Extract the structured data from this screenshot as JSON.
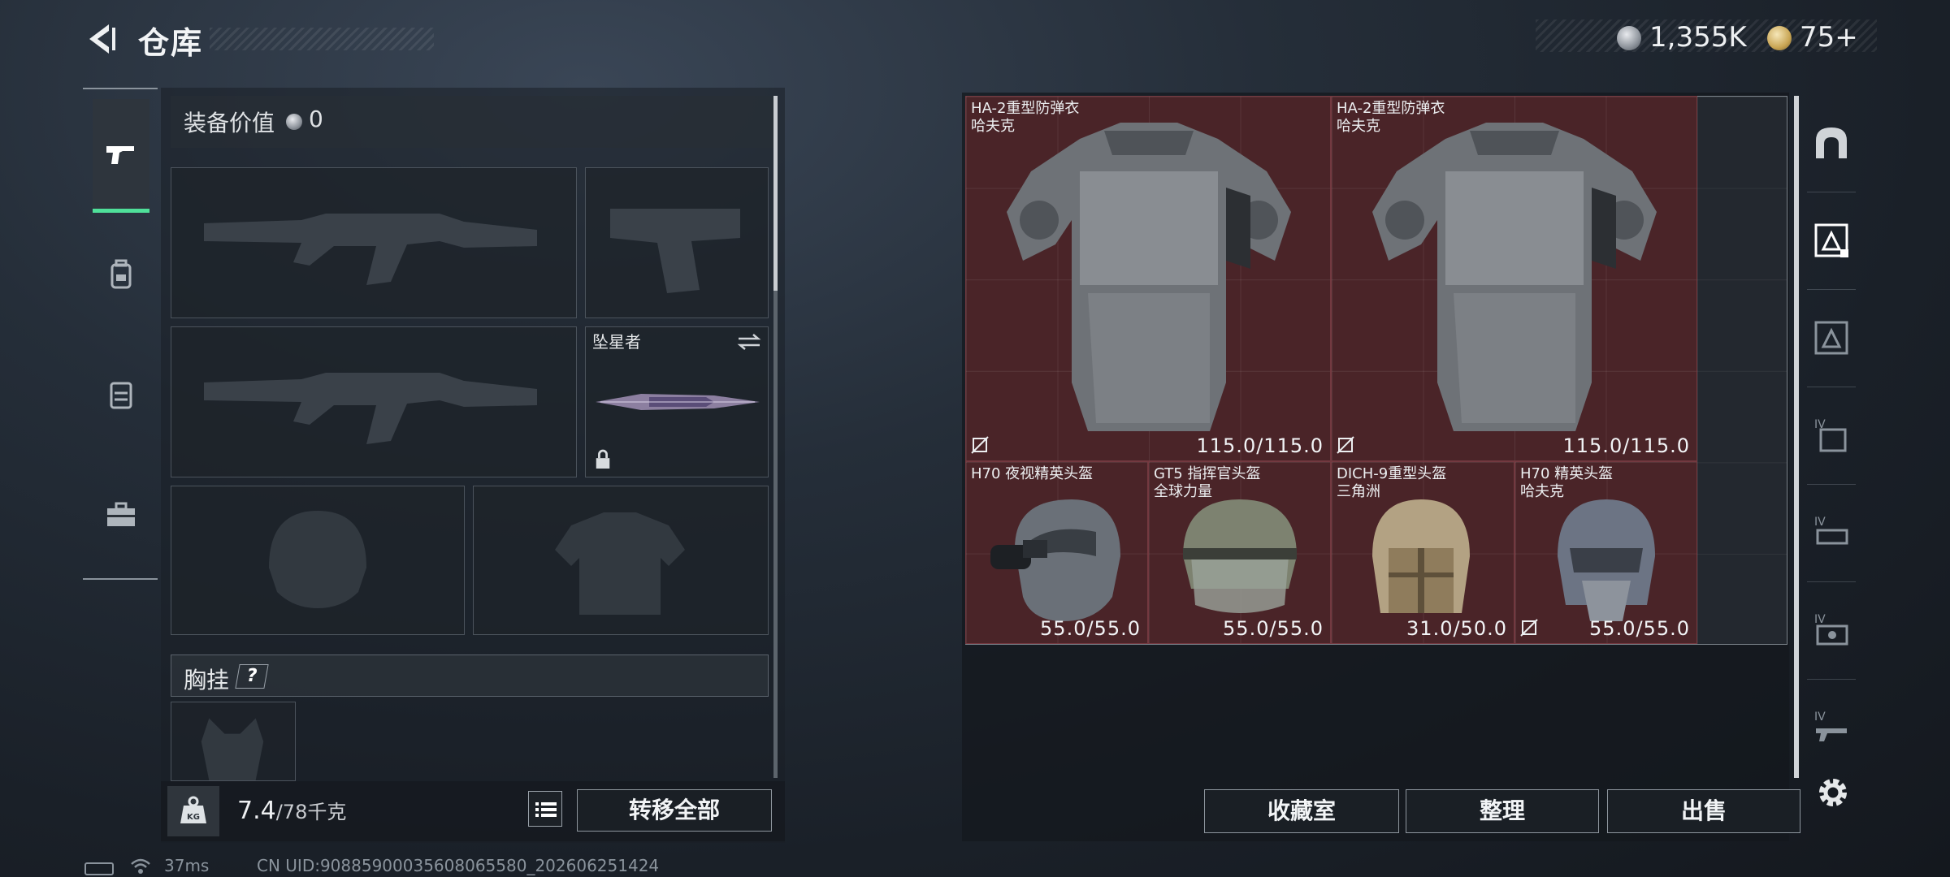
{
  "header": {
    "title": "仓库",
    "currency": {
      "coin_value": "1,355K",
      "ticket_value": "75+"
    }
  },
  "left_tabs": [
    {
      "icon": "pistol-icon",
      "active": true
    },
    {
      "icon": "backpack-icon",
      "active": false
    },
    {
      "icon": "vest-icon",
      "active": false
    },
    {
      "icon": "toolbox-icon",
      "active": false
    }
  ],
  "loadout": {
    "value_label": "装备价值",
    "value": "0",
    "knife_name": "坠星者",
    "chest_label": "胸挂",
    "chest_help": "?",
    "weight": "7.4",
    "weight_max": "/78千克",
    "transfer_all": "转移全部"
  },
  "status": {
    "ping": "37ms",
    "uid": "CN UID:90885900035608065580_202606251424"
  },
  "stash": {
    "items": [
      {
        "name": "HA-2重型防弹衣",
        "sub": "哈夫克",
        "durability": "115.0/115.0"
      },
      {
        "name": "HA-2重型防弹衣",
        "sub": "哈夫克",
        "durability": "115.0/115.0"
      },
      {
        "name": "H70 夜视精英头盔",
        "sub": "",
        "durability": "55.0/55.0"
      },
      {
        "name": "GT5 指挥官头盔",
        "sub": "全球力量",
        "durability": "55.0/55.0"
      },
      {
        "name": "DICH-9重型头盔",
        "sub": "三角洲",
        "durability": "31.0/50.0"
      },
      {
        "name": "H70 精英头盔",
        "sub": "哈夫克",
        "durability": "55.0/55.0"
      }
    ],
    "buttons": {
      "collection": "收藏室",
      "organize": "整理",
      "sell": "出售"
    }
  },
  "right_categories": [
    {
      "icon": "arch-icon"
    },
    {
      "icon": "armor-tier-icon"
    },
    {
      "icon": "armor-tier-icon"
    },
    {
      "icon": "tier-iv-backpack-icon"
    },
    {
      "icon": "tier-iv-rig-icon"
    },
    {
      "icon": "tier-iv-case-icon"
    },
    {
      "icon": "tier-iv-weapon-icon"
    }
  ],
  "colors": {
    "accent_green": "#4fe09a",
    "item_bg": "#4a2428"
  }
}
